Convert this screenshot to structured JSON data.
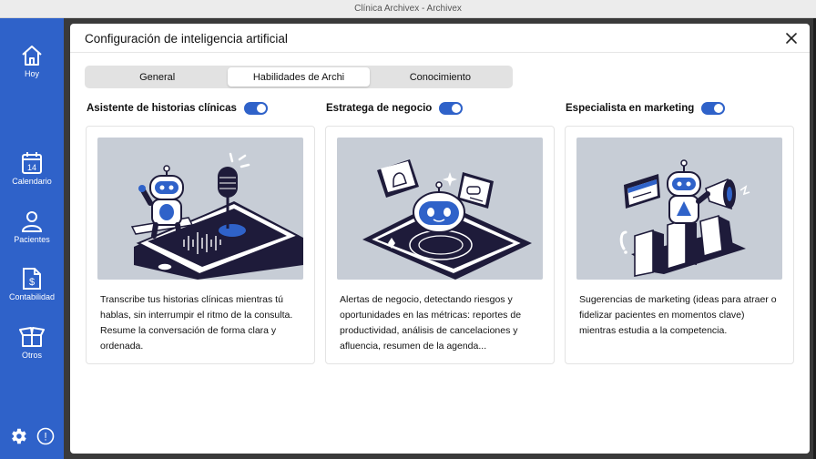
{
  "window": {
    "title": "Clínica Archivex - Archivex"
  },
  "sidebar": {
    "items": [
      {
        "label": "Hoy",
        "icon": "home-icon"
      },
      {
        "label": "Calendario",
        "icon": "calendar-icon",
        "badge": "14"
      },
      {
        "label": "Pacientes",
        "icon": "user-icon"
      },
      {
        "label": "Contabilidad",
        "icon": "document-dollar-icon",
        "glyph": "$"
      },
      {
        "label": "Otros",
        "icon": "box-icon"
      }
    ],
    "bottom": {
      "settings_icon": "gear-icon",
      "info_icon": "info-icon",
      "info_glyph": "!"
    }
  },
  "modal": {
    "title": "Configuración de inteligencia artificial",
    "tabs": [
      {
        "label": "General",
        "active": false
      },
      {
        "label": "Habilidades de Archi",
        "active": true
      },
      {
        "label": "Conocimiento",
        "active": false
      }
    ],
    "cards": [
      {
        "title": "Asistente de historias clínicas",
        "enabled": true,
        "description": "Transcribe tus historias clínicas mientras tú hablas, sin interrumpir el ritmo de la consulta. Resume la conversación de forma clara y ordenada."
      },
      {
        "title": "Estratega de negocio",
        "enabled": true,
        "description": "Alertas de negocio, detectando riesgos y oportunidades en las métricas: reportes de productividad, análisis de cancelaciones y afluencia, resumen de la agenda..."
      },
      {
        "title": "Especialista en marketing",
        "enabled": true,
        "description": "Sugerencias de marketing (ideas para atraer o fidelizar pacientes en momentos clave) mientras estudia a la competencia."
      }
    ]
  },
  "colors": {
    "sidebar": "#2f62c9",
    "accent": "#2f62c9",
    "illustration_bg": "#c7cdd6",
    "illustration_dark": "#1e1b3a"
  }
}
